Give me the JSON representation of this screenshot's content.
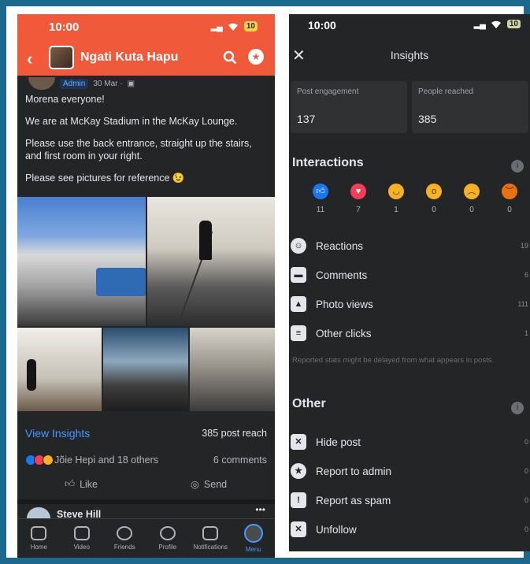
{
  "left": {
    "status": {
      "time": "10:00",
      "battery": "10"
    },
    "header": {
      "group_name": "Ngati Kuta Hapu"
    },
    "post": {
      "badge": "Admin",
      "date": "30 Mar ·",
      "paragraphs": [
        "Morena everyone!",
        "We are at McKay Stadium in the McKay Lounge.",
        "Please use the back entrance, straight up the stairs, and first room in your right.",
        "Please see pictures for reference 😉"
      ],
      "view_insights": "View Insights",
      "post_reach": "385 post reach",
      "reactions_text": "Jõie Hepi and 18 others",
      "comments": "6 comments",
      "like_label": "Like",
      "send_label": "Send"
    },
    "next_post": {
      "author": "Steve Hill",
      "more": "•••"
    },
    "nav": {
      "home": "Home",
      "video": "Video",
      "friends": "Friends",
      "profile": "Profile",
      "notifications": "Notifications",
      "menu": "Menu"
    }
  },
  "right": {
    "status": {
      "time": "10:00",
      "battery": "10"
    },
    "title": "Insights",
    "stats": [
      {
        "label": "Post engagement",
        "value": "137"
      },
      {
        "label": "People reached",
        "value": "385"
      }
    ],
    "interactions_title": "Interactions",
    "reactions": [
      {
        "name": "like",
        "count": "11",
        "color": "#1877f2",
        "glyph": "👍"
      },
      {
        "name": "love",
        "count": "7",
        "color": "#f33e58",
        "glyph": "♥"
      },
      {
        "name": "haha",
        "count": "1",
        "color": "#f7b125",
        "glyph": "😆"
      },
      {
        "name": "wow",
        "count": "0",
        "color": "#f7b125",
        "glyph": "😮"
      },
      {
        "name": "sad",
        "count": "0",
        "color": "#f7b125",
        "glyph": "😥"
      },
      {
        "name": "angry",
        "count": "0",
        "color": "#e9710f",
        "glyph": "😡"
      }
    ],
    "interaction_rows": [
      {
        "label": "Reactions",
        "value": "19"
      },
      {
        "label": "Comments",
        "value": "6"
      },
      {
        "label": "Photo views",
        "value": "111"
      },
      {
        "label": "Other clicks",
        "value": "1"
      }
    ],
    "note": "Reported stats might be delayed from what appears in posts.",
    "other_title": "Other",
    "other_rows": [
      {
        "label": "Hide post",
        "value": "0"
      },
      {
        "label": "Report to admin",
        "value": "0"
      },
      {
        "label": "Report as spam",
        "value": "0"
      },
      {
        "label": "Unfollow",
        "value": "0"
      }
    ]
  }
}
